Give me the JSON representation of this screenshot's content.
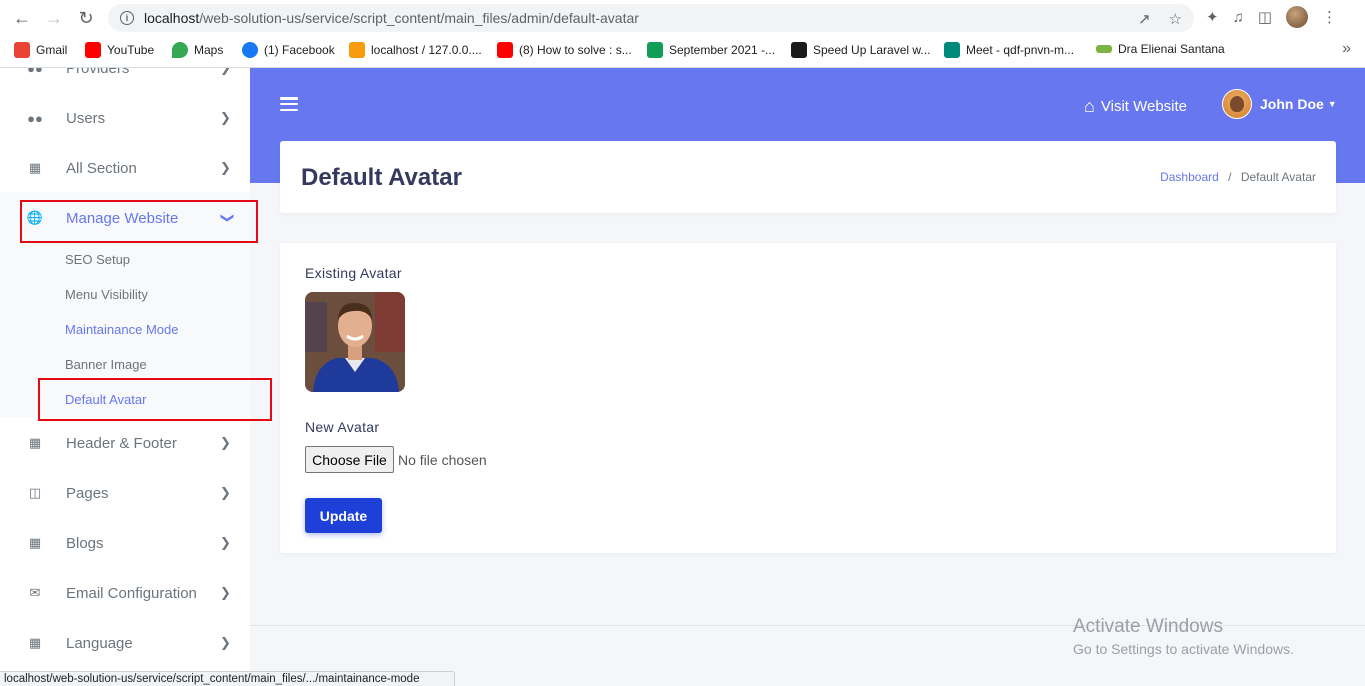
{
  "browser": {
    "url_host": "localhost",
    "url_path": "/web-solution-us/service/script_content/main_files/admin/default-avatar",
    "bookmarks": [
      {
        "label": "Gmail",
        "color": "#ea4335"
      },
      {
        "label": "YouTube",
        "color": "#ff0000"
      },
      {
        "label": "Maps",
        "color": "#34a853"
      },
      {
        "label": "(1) Facebook",
        "color": "#1877f2"
      },
      {
        "label": "localhost / 127.0.0....",
        "color": "#f89c0e"
      },
      {
        "label": "(8) How to solve : s...",
        "color": "#ff0000"
      },
      {
        "label": "September 2021 -...",
        "color": "#0f9d58"
      },
      {
        "label": "Speed Up Laravel w...",
        "color": "#1a1a1a"
      },
      {
        "label": "Meet - qdf-pnvn-m...",
        "color": "#00897b"
      },
      {
        "label": "Dra Elienai Santana",
        "color": "#7cb342"
      }
    ],
    "status_url": "localhost/web-solution-us/service/script_content/main_files/.../maintainance-mode"
  },
  "sidebar": {
    "items": [
      {
        "label": "Providers",
        "icon": "users-icon"
      },
      {
        "label": "Users",
        "icon": "users-icon"
      },
      {
        "label": "All Section",
        "icon": "grid-icon"
      },
      {
        "label": "Manage Website",
        "icon": "globe-icon"
      },
      {
        "label": "Header & Footer",
        "icon": "grid-icon"
      },
      {
        "label": "Pages",
        "icon": "columns-icon"
      },
      {
        "label": "Blogs",
        "icon": "grid-icon"
      },
      {
        "label": "Email Configuration",
        "icon": "envelope-icon"
      },
      {
        "label": "Language",
        "icon": "grid-icon"
      }
    ],
    "submenu": [
      {
        "label": "SEO Setup"
      },
      {
        "label": "Menu Visibility"
      },
      {
        "label": "Maintainance Mode"
      },
      {
        "label": "Banner Image"
      },
      {
        "label": "Default Avatar"
      }
    ]
  },
  "topbar": {
    "visit_label": "Visit Website",
    "user_name": "John Doe"
  },
  "header": {
    "title": "Default Avatar",
    "breadcrumb_link": "Dashboard",
    "breadcrumb_sep": "/",
    "breadcrumb_current": "Default Avatar"
  },
  "form": {
    "existing_label": "Existing Avatar",
    "new_label": "New Avatar",
    "file_button": "Choose File",
    "file_status": "No file chosen",
    "submit_label": "Update"
  },
  "watermark": {
    "line1": "Activate Windows",
    "line2": "Go to Settings to activate Windows."
  },
  "colors": {
    "primary": "#6777ef",
    "update_button": "#1f3fd9",
    "highlight_box": "#e50914"
  }
}
